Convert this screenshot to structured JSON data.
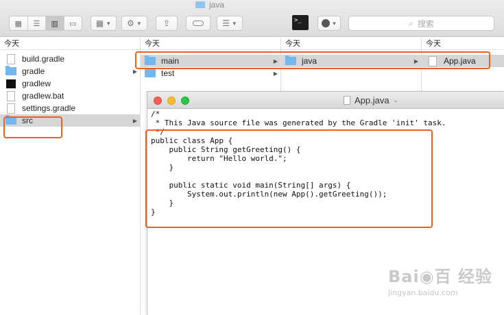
{
  "window": {
    "title": "java"
  },
  "toolbar": {
    "view_icons": [
      "icon-view-icon",
      "list-view-icon",
      "column-view-icon",
      "gallery-view-icon"
    ],
    "search_placeholder": "搜索"
  },
  "columns": [
    {
      "header": "今天",
      "items": [
        {
          "label": "build.gradle",
          "type": "doc"
        },
        {
          "label": "gradle",
          "type": "folder",
          "arrow": true
        },
        {
          "label": "gradlew",
          "type": "exec"
        },
        {
          "label": "gradlew.bat",
          "type": "doc"
        },
        {
          "label": "settings.gradle",
          "type": "doc"
        },
        {
          "label": "src",
          "type": "folder",
          "arrow": true,
          "selected": true
        }
      ]
    },
    {
      "header": "今天",
      "items": [
        {
          "label": "main",
          "type": "folder",
          "arrow": true,
          "selected": true
        },
        {
          "label": "test",
          "type": "folder",
          "arrow": true
        }
      ]
    },
    {
      "header": "今天",
      "items": [
        {
          "label": "java",
          "type": "folder",
          "arrow": true,
          "selected": true
        }
      ]
    },
    {
      "header": "今天",
      "items": [
        {
          "label": "App.java",
          "type": "doc",
          "selected": true
        }
      ]
    }
  ],
  "editor": {
    "title": "App.java",
    "code_lines": [
      "/*",
      " * This Java source file was generated by the Gradle 'init' task.",
      " */",
      "public class App {",
      "    public String getGreeting() {",
      "        return \"Hello world.\";",
      "    }",
      "",
      "    public static void main(String[] args) {",
      "        System.out.println(new App().getGreeting());",
      "    }",
      "}"
    ]
  },
  "watermark": {
    "logo": "Bai◉百 经验",
    "url": "jingyan.baidu.com"
  },
  "colors": {
    "highlight": "#ee5e1f",
    "folder": "#73b7ef",
    "selection": "#d6d6d6"
  }
}
